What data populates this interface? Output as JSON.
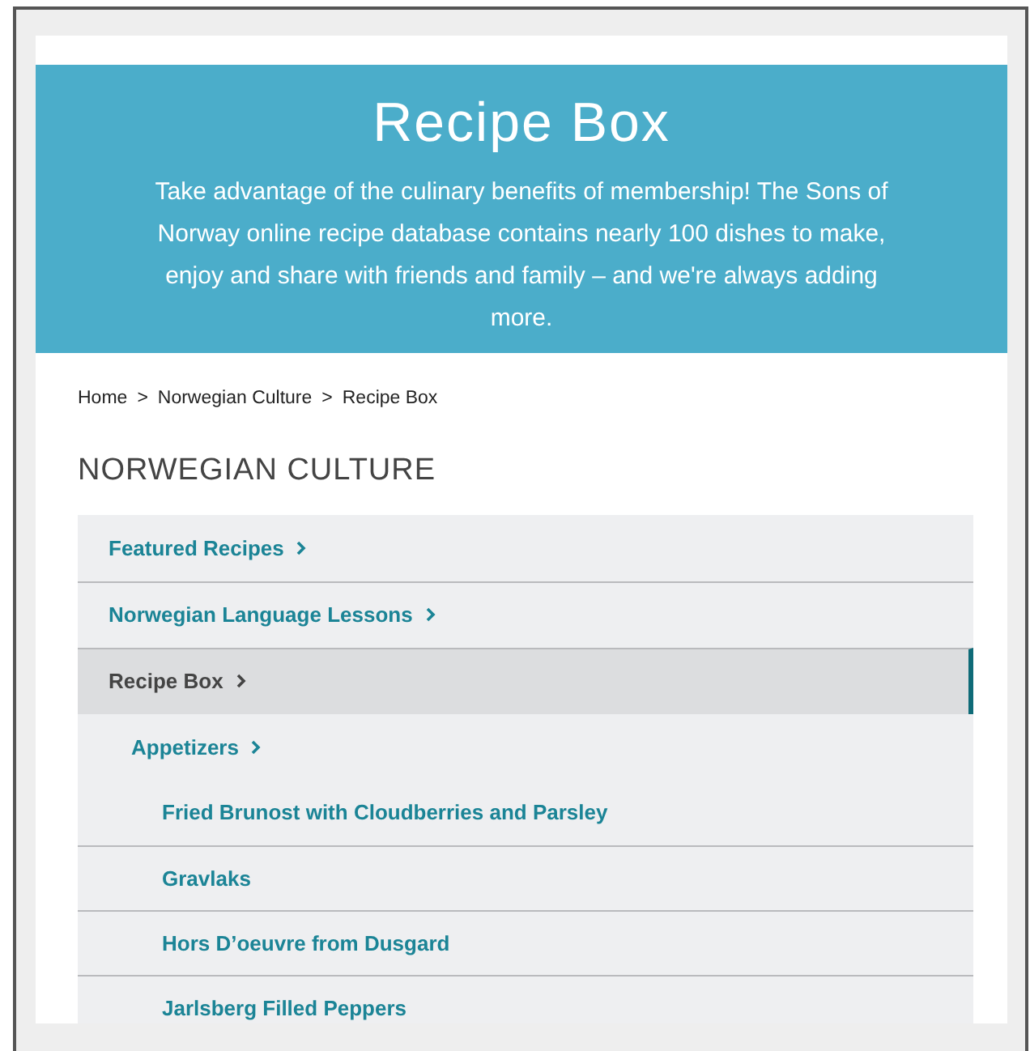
{
  "banner": {
    "title": "Recipe Box",
    "text": "Take advantage of the culinary benefits of membership! The Sons of Norway online recipe database contains nearly 100 dishes to make, enjoy and share with friends and family – and we're always adding more."
  },
  "breadcrumb": [
    "Home",
    "Norwegian Culture",
    "Recipe Box"
  ],
  "breadcrumb_separator": ">",
  "section_heading": "NORWEGIAN CULTURE",
  "nav": [
    {
      "label": "Featured Recipes",
      "kind": "category",
      "selected": false
    },
    {
      "label": "Norwegian Language Lessons",
      "kind": "category",
      "selected": false
    },
    {
      "label": "Recipe Box",
      "kind": "category",
      "selected": true,
      "children": [
        {
          "label": "Appetizers",
          "kind": "category",
          "selected": false,
          "children": [
            {
              "label": "Fried Brunost with Cloudberries and Parsley",
              "kind": "recipe",
              "selected": false
            },
            {
              "label": "Gravlaks",
              "kind": "recipe",
              "selected": false
            },
            {
              "label": "Hors D’oeuvre from Dusgard",
              "kind": "recipe",
              "selected": false
            },
            {
              "label": "Jarlsberg Filled Peppers",
              "kind": "recipe",
              "selected": false
            }
          ]
        }
      ]
    }
  ]
}
